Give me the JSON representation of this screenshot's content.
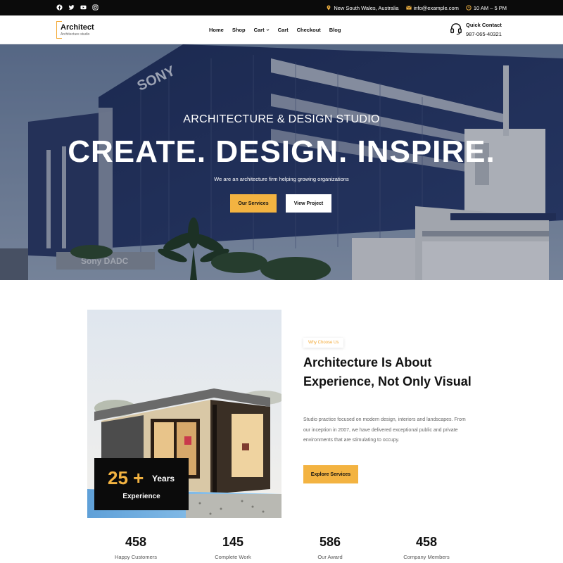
{
  "topbar": {
    "social_icons": [
      "facebook-icon",
      "twitter-icon",
      "youtube-icon",
      "instagram-icon"
    ],
    "location": "New South Wales, Australia",
    "email": "info@example.com",
    "hours": "10 AM – 5 PM"
  },
  "header": {
    "logo_title": "Architect",
    "logo_sub": "Architecture studio",
    "nav": [
      "Home",
      "Shop",
      "Cart",
      "Cart",
      "Checkout",
      "Blog"
    ],
    "quick_contact_label": "Quick Contact",
    "phone": "987-065-40321"
  },
  "hero": {
    "subtitle": "ARCHITECTURE & DESIGN STUDIO",
    "title": "CREATE. DESIGN. INSPIRE.",
    "description": "We are an architecture firm helping growing organizations",
    "primary_button": "Our Services",
    "secondary_button": "View Project",
    "signage": [
      "SONY",
      "Sony DADC"
    ]
  },
  "about": {
    "experience_number": "25",
    "experience_plus": "+",
    "experience_unit": "Years",
    "experience_label": "Experience",
    "badge": "Why Choose Us",
    "title": "Architecture Is About Experience, Not Only Visual",
    "text": "Studio practice focused on modern design, interiors and landscapes. From our inception in 2007, we have delivered exceptional public and private environments that are stimulating to occupy.",
    "button": "Explore Services"
  },
  "stats": [
    {
      "number": "458",
      "label": "Happy Customers"
    },
    {
      "number": "145",
      "label": "Complete Work"
    },
    {
      "number": "586",
      "label": "Our Award"
    },
    {
      "number": "458",
      "label": "Company Members"
    }
  ],
  "colors": {
    "accent": "#f3b341",
    "topbar": "#0b0b0b",
    "text": "#111111"
  }
}
